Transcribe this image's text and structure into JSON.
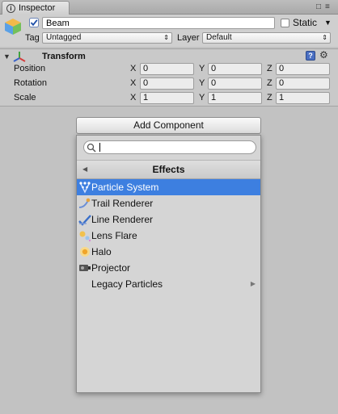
{
  "tab": {
    "label": "Inspector"
  },
  "header": {
    "object_name": "Beam",
    "static_label": "Static",
    "tag_label": "Tag",
    "tag_value": "Untagged",
    "layer_label": "Layer",
    "layer_value": "Default"
  },
  "transform": {
    "title": "Transform",
    "rows": [
      {
        "label": "Position",
        "x": "0",
        "y": "0",
        "z": "0"
      },
      {
        "label": "Rotation",
        "x": "0",
        "y": "0",
        "z": "0"
      },
      {
        "label": "Scale",
        "x": "1",
        "y": "1",
        "z": "1"
      }
    ],
    "axes": {
      "x": "X",
      "y": "Y",
      "z": "Z"
    }
  },
  "add_component": {
    "button_label": "Add Component",
    "search_value": "",
    "category": "Effects",
    "items": [
      {
        "label": "Particle System",
        "icon": "particle-system-icon",
        "selected": true
      },
      {
        "label": "Trail Renderer",
        "icon": "trail-renderer-icon"
      },
      {
        "label": "Line Renderer",
        "icon": "line-renderer-icon"
      },
      {
        "label": "Lens Flare",
        "icon": "lens-flare-icon"
      },
      {
        "label": "Halo",
        "icon": "halo-icon"
      },
      {
        "label": "Projector",
        "icon": "projector-icon"
      },
      {
        "label": "Legacy Particles",
        "icon": "",
        "submenu": true
      }
    ]
  },
  "colors": {
    "selection": "#3d7fe0",
    "panel": "#c2c2c2",
    "popup": "#d5d5d5"
  }
}
